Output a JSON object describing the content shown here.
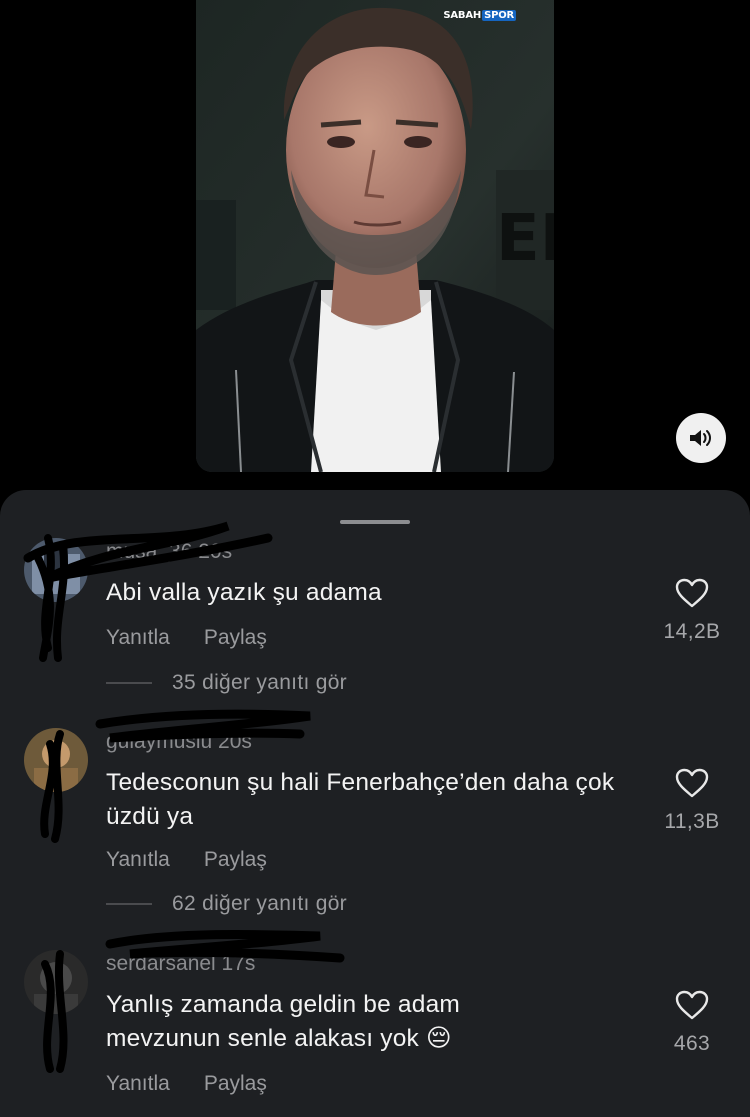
{
  "video": {
    "watermark_part1": "SABAH",
    "watermark_part2": "SPOR"
  },
  "comments": [
    {
      "username": "musa_36 20s",
      "text": "Abi valla yazık şu adama",
      "reply_label": "Yanıtla",
      "share_label": "Paylaş",
      "more_replies": "35 diğer yanıtı gör",
      "likes": "14,2B"
    },
    {
      "username": "gulaymuslu 20s",
      "text": "Tedesconun şu hali Fenerbahçe’den daha çok üzdü  ya",
      "reply_label": "Yanıtla",
      "share_label": "Paylaş",
      "more_replies": "62 diğer yanıtı gör",
      "likes": "11,3B"
    },
    {
      "username": "serdarsanel 17s",
      "text": "Yanlış zamanda geldin be adam mevzunun senle alakası yok 😔",
      "reply_label": "Yanıtla",
      "share_label": "Paylaş",
      "likes": "463"
    }
  ],
  "icons": {
    "sound": "speaker-icon",
    "like": "heart-outline-icon"
  },
  "colors": {
    "sheet_background": "#1e2023",
    "page_background": "#000000",
    "secondary_text": "#9a9b9e"
  }
}
